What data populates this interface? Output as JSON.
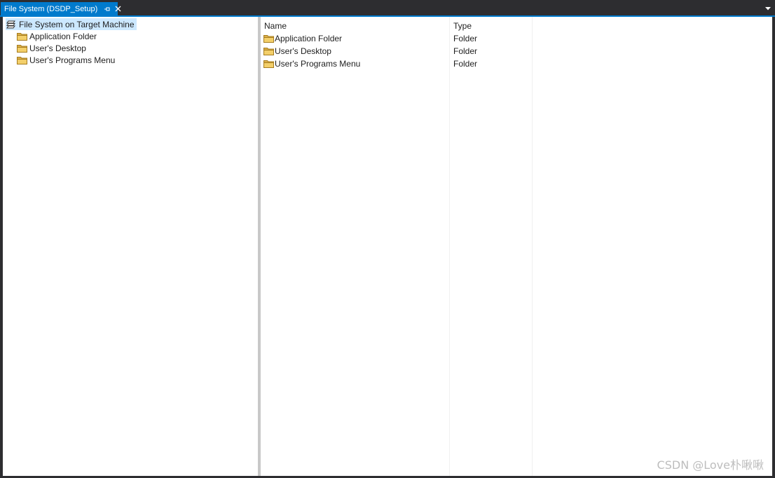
{
  "tab": {
    "title": "File System (DSDP_Setup)"
  },
  "tree": {
    "root": {
      "label": "File System on Target Machine",
      "icon": "drive-stack-icon"
    },
    "items": [
      {
        "label": "Application Folder",
        "icon": "folder-icon"
      },
      {
        "label": "User's Desktop",
        "icon": "folder-icon"
      },
      {
        "label": "User's Programs Menu",
        "icon": "folder-icon"
      }
    ]
  },
  "list": {
    "columns": [
      "Name",
      "Type"
    ],
    "rows": [
      {
        "name": "Application Folder",
        "type": "Folder",
        "icon": "folder-icon"
      },
      {
        "name": "User's Desktop",
        "type": "Folder",
        "icon": "folder-icon"
      },
      {
        "name": "User's Programs Menu",
        "type": "Folder",
        "icon": "folder-icon"
      }
    ]
  },
  "watermark": "CSDN @Love朴啾啾",
  "colors": {
    "accent": "#007acc",
    "selection": "#cce8ff",
    "folder": "#e8b84a",
    "chrome": "#2d2d30"
  }
}
